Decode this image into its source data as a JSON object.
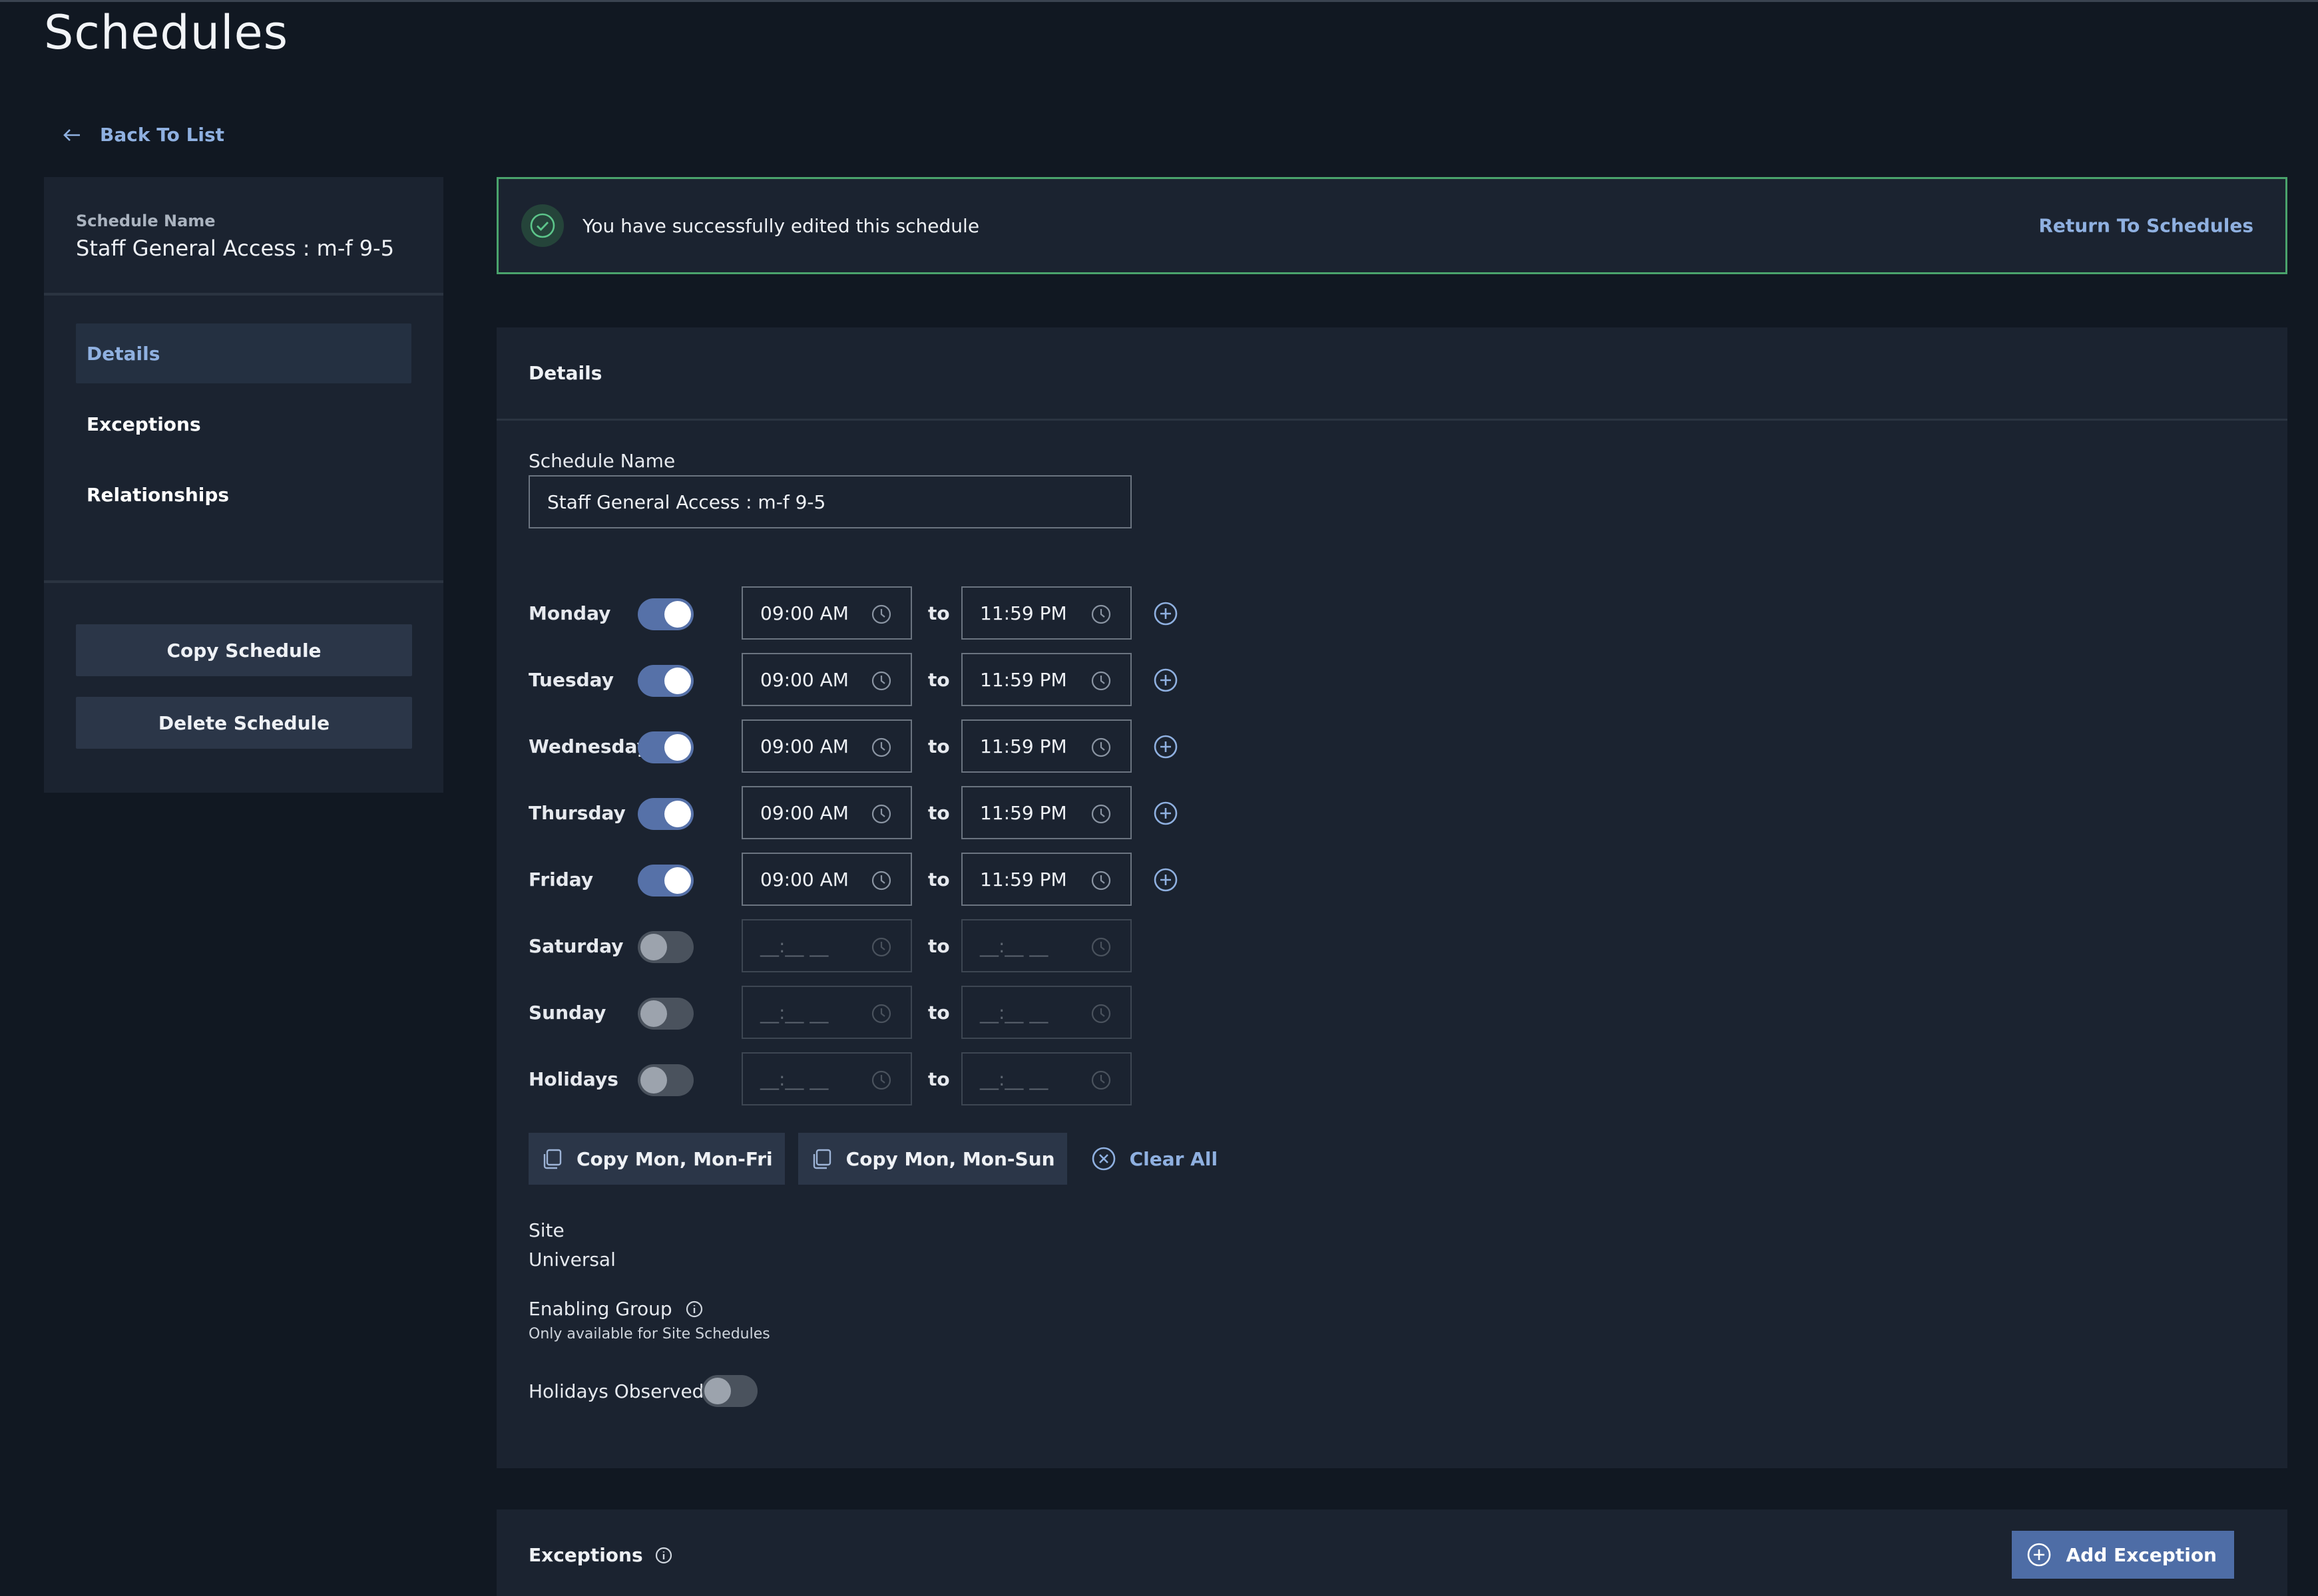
{
  "page": {
    "title": "Schedules"
  },
  "back": {
    "label": "Back To List"
  },
  "sidebar": {
    "name_label": "Schedule Name",
    "name_value": "Staff General Access : m-f 9-5",
    "nav": [
      "Details",
      "Exceptions",
      "Relationships"
    ],
    "active_nav": "Details",
    "actions": {
      "copy": "Copy Schedule",
      "delete": "Delete Schedule"
    }
  },
  "banner": {
    "message": "You have successfully edited this schedule",
    "link": "Return To Schedules",
    "status_color": "#4aa36c"
  },
  "details": {
    "title": "Details",
    "name_label": "Schedule Name",
    "name_value": "Staff General Access : m-f 9-5",
    "to_word": "to",
    "days": [
      {
        "name": "Monday",
        "enabled": true,
        "start": "09:00 AM",
        "end": "11:59 PM"
      },
      {
        "name": "Tuesday",
        "enabled": true,
        "start": "09:00 AM",
        "end": "11:59 PM"
      },
      {
        "name": "Wednesday",
        "enabled": true,
        "start": "09:00 AM",
        "end": "11:59 PM"
      },
      {
        "name": "Thursday",
        "enabled": true,
        "start": "09:00 AM",
        "end": "11:59 PM"
      },
      {
        "name": "Friday",
        "enabled": true,
        "start": "09:00 AM",
        "end": "11:59 PM"
      },
      {
        "name": "Saturday",
        "enabled": false,
        "start": "__:__ __",
        "end": "__:__ __"
      },
      {
        "name": "Sunday",
        "enabled": false,
        "start": "__:__ __",
        "end": "__:__ __"
      },
      {
        "name": "Holidays",
        "enabled": false,
        "start": "__:__ __",
        "end": "__:__ __"
      }
    ],
    "copy_mon_fri": "Copy Mon, Mon-Fri",
    "copy_mon_sun": "Copy Mon, Mon-Sun",
    "clear_all": "Clear All",
    "site_label": "Site",
    "site_value": "Universal",
    "enabling_group_label": "Enabling Group",
    "enabling_group_note": "Only available for Site Schedules",
    "holidays_observed_label": "Holidays Observed",
    "holidays_observed": false
  },
  "exceptions": {
    "title": "Exceptions",
    "add_label": "Add Exception"
  },
  "colors": {
    "accent": "#8fb0e0",
    "toggle_on": "#5671a8",
    "button_primary": "#4e6da6",
    "background": "#111822",
    "panel": "#1b2330"
  },
  "icons": {
    "back": "arrow-left-icon",
    "success": "checkmark-circle-icon",
    "time": "clock-icon",
    "add": "plus-circle-icon",
    "copy": "copy-icon",
    "clear": "close-circle-icon",
    "info": "info-icon"
  }
}
